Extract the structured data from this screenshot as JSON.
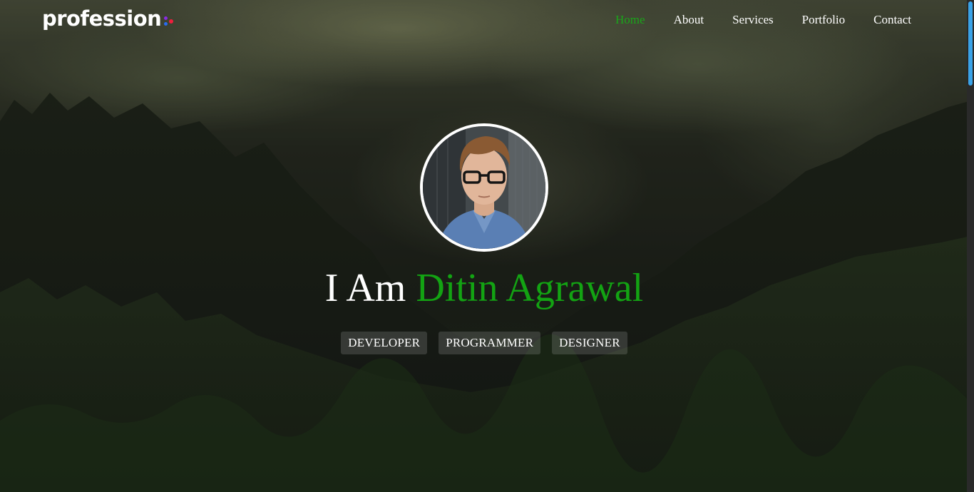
{
  "brand": {
    "logo_text": "profession"
  },
  "nav": {
    "items": [
      {
        "label": "Home",
        "active": true
      },
      {
        "label": "About",
        "active": false
      },
      {
        "label": "Services",
        "active": false
      },
      {
        "label": "Portfolio",
        "active": false
      },
      {
        "label": "Contact",
        "active": false
      }
    ]
  },
  "hero": {
    "headline_prefix": "I Am",
    "headline_name": "Ditin Agrawal",
    "roles": [
      "DEVELOPER",
      "PROGRAMMER",
      "DESIGNER"
    ]
  },
  "colors": {
    "accent": "#13a313",
    "logo_dot_red": "#f01e3c",
    "logo_dot_purple": "#8a2be2",
    "logo_dot_blue": "#2a6bf0",
    "scroll_thumb": "#3aa3e8"
  },
  "scroll_position": 0
}
